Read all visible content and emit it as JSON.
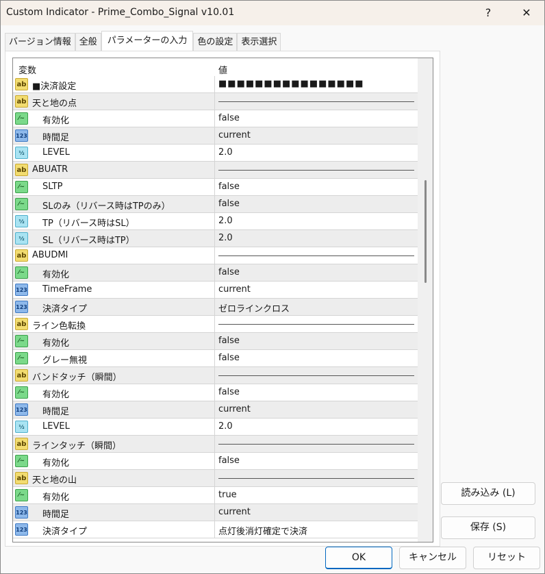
{
  "window": {
    "title": "Custom Indicator - Prime_Combo_Signal v10.01",
    "help": "?",
    "close": "✕"
  },
  "tabs": [
    "バージョン情報",
    "全般",
    "パラメーターの入力",
    "色の設定",
    "表示選択"
  ],
  "table": {
    "col_variable": "変数",
    "col_value": "値",
    "rows": [
      {
        "type": "ab",
        "name": "■決済設定",
        "value": "■■■■■■■■■■■■■■■■",
        "indent": false
      },
      {
        "type": "ab",
        "name": "天と地の点",
        "value": "",
        "sep": true
      },
      {
        "type": "bool",
        "name": "有効化",
        "value": "false",
        "indent": true
      },
      {
        "type": "int",
        "name": "時間足",
        "value": "current",
        "indent": true
      },
      {
        "type": "dbl",
        "name": "LEVEL",
        "value": "2.0",
        "indent": true
      },
      {
        "type": "ab",
        "name": "ABUATR",
        "value": "",
        "sep": true
      },
      {
        "type": "bool",
        "name": "SLTP",
        "value": "false",
        "indent": true
      },
      {
        "type": "bool",
        "name": "SLのみ（リバース時はTPのみ）",
        "value": "false",
        "indent": true
      },
      {
        "type": "dbl",
        "name": "TP（リバース時はSL）",
        "value": "2.0",
        "indent": true
      },
      {
        "type": "dbl",
        "name": "SL（リバース時はTP）",
        "value": "2.0",
        "indent": true
      },
      {
        "type": "ab",
        "name": "ABUDMI",
        "value": "",
        "sep": true
      },
      {
        "type": "bool",
        "name": "有効化",
        "value": "false",
        "indent": true
      },
      {
        "type": "int",
        "name": "TimeFrame",
        "value": "current",
        "indent": true
      },
      {
        "type": "int",
        "name": "決済タイプ",
        "value": "ゼロラインクロス",
        "indent": true
      },
      {
        "type": "ab",
        "name": "ライン色転換",
        "value": "",
        "sep": true
      },
      {
        "type": "bool",
        "name": "有効化",
        "value": "false",
        "indent": true
      },
      {
        "type": "bool",
        "name": "グレー無視",
        "value": "false",
        "indent": true
      },
      {
        "type": "ab",
        "name": "バンドタッチ（瞬間）",
        "value": "",
        "sep": true
      },
      {
        "type": "bool",
        "name": "有効化",
        "value": "false",
        "indent": true
      },
      {
        "type": "int",
        "name": "時間足",
        "value": "current",
        "indent": true
      },
      {
        "type": "dbl",
        "name": "LEVEL",
        "value": "2.0",
        "indent": true
      },
      {
        "type": "ab",
        "name": "ラインタッチ（瞬間）",
        "value": "",
        "sep": true
      },
      {
        "type": "bool",
        "name": "有効化",
        "value": "false",
        "indent": true
      },
      {
        "type": "ab",
        "name": "天と地の山",
        "value": "",
        "sep": true
      },
      {
        "type": "bool",
        "name": "有効化",
        "value": "true",
        "indent": true
      },
      {
        "type": "int",
        "name": "時間足",
        "value": "current",
        "indent": true
      },
      {
        "type": "int",
        "name": "決済タイプ",
        "value": "点灯後消灯確定で決済",
        "indent": true
      }
    ]
  },
  "icons": {
    "ab": "ab",
    "bool": "⁄~",
    "int": "123",
    "dbl": "½"
  },
  "buttons": {
    "load": "読み込み (L)",
    "save": "保存 (S)",
    "ok": "OK",
    "cancel": "キャンセル",
    "reset": "リセット"
  }
}
